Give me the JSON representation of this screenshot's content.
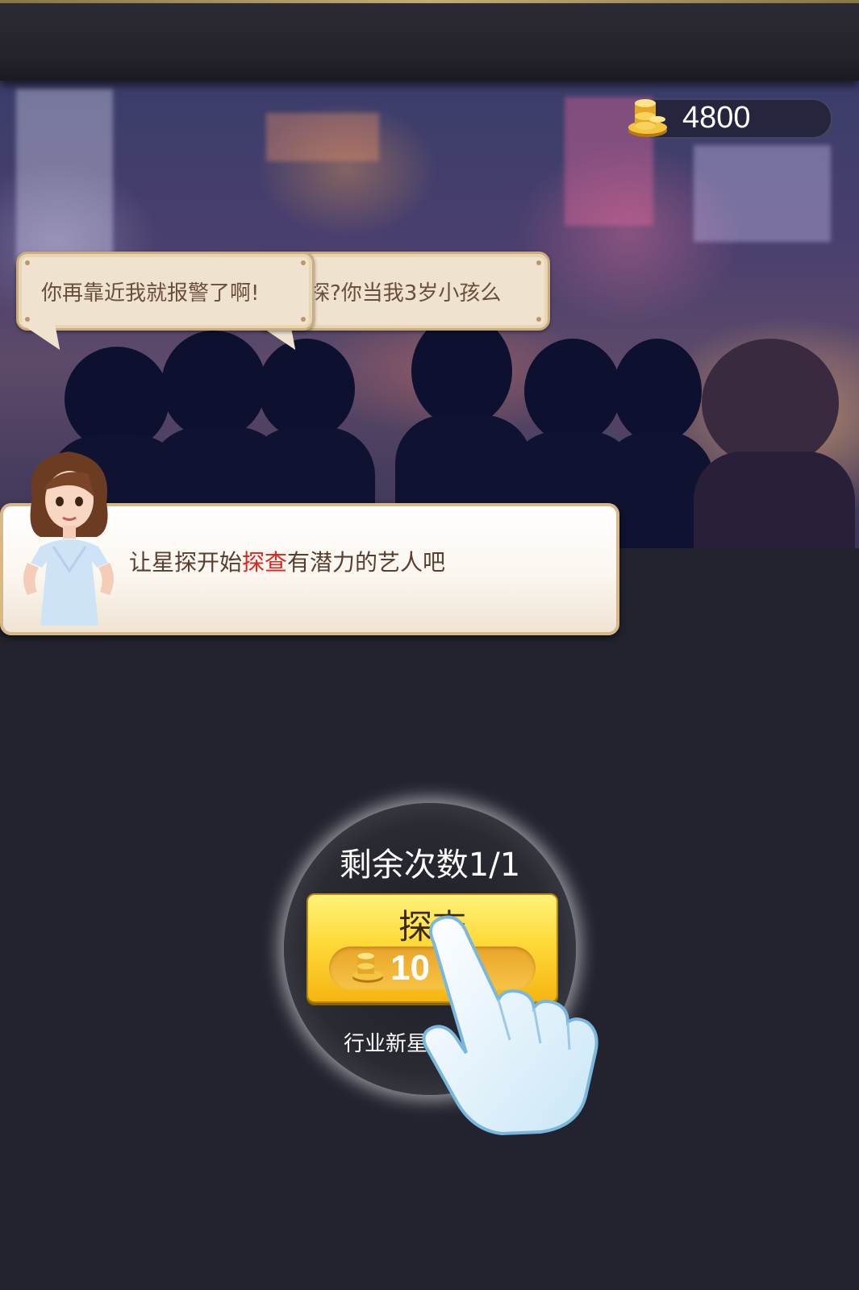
{
  "header": {
    "coins": "4800",
    "coin_icon": "gold-coin-stack-icon"
  },
  "speech_bubbles": [
    {
      "text": "你再靠近我就报警了啊!"
    },
    {
      "text": "探?你当我3岁小孩么"
    }
  ],
  "guide": {
    "text_before": "让星探开始",
    "text_highlight": "探查",
    "text_after": "有潜力的艺人吧",
    "highlight_color": "#e2231a"
  },
  "scout": {
    "remaining": "剩余次数1/1",
    "button_label": "探查",
    "cost_value": "10",
    "cost_icon": "gold-coin-stack-icon",
    "subtitle": "行业新星"
  },
  "tutorial": {
    "pointer_icon": "hand-pointer-icon"
  },
  "colors": {
    "background": "#23232f",
    "button_yellow": "#ffd93a",
    "bubble_bg": "#efe3d0",
    "bubble_text": "#6b4e3a"
  }
}
